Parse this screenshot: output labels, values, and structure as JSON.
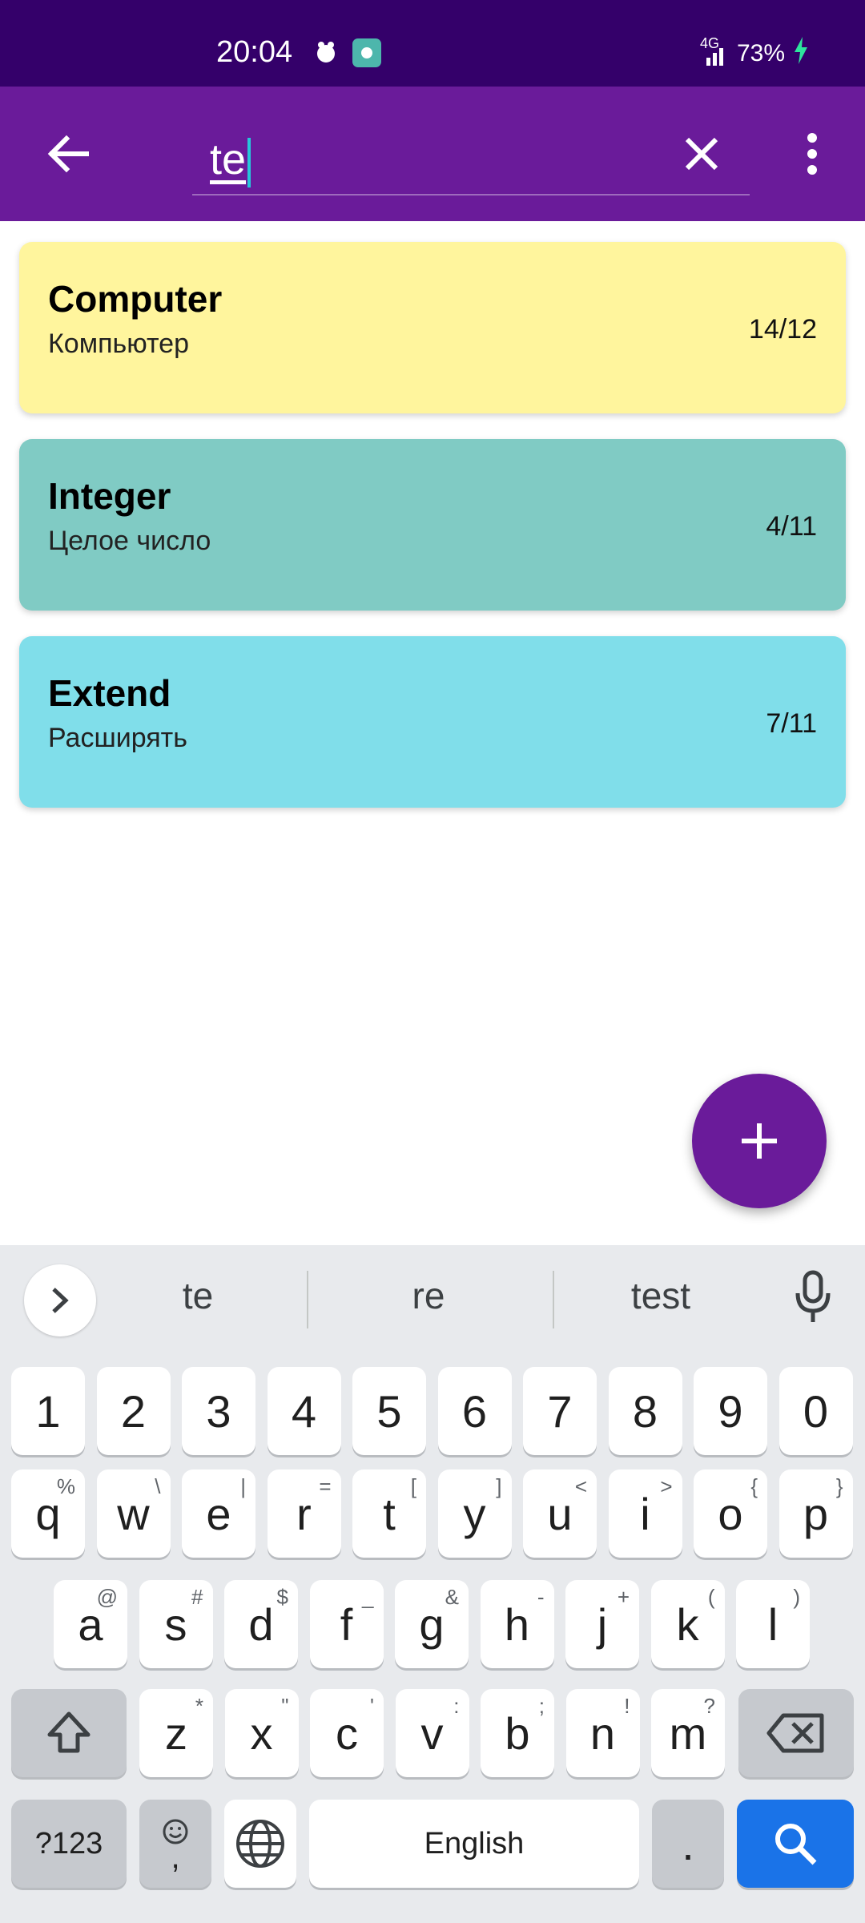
{
  "status_bar": {
    "time": "20:04",
    "network": "4G",
    "battery": "73%",
    "icons": [
      "notification-icon",
      "accessibility-icon",
      "signal-icon",
      "battery-charging-icon"
    ]
  },
  "app_bar": {
    "search_value": "te",
    "icons": [
      "back-arrow-icon",
      "clear-icon",
      "more-vert-icon"
    ]
  },
  "results": [
    {
      "word": "Computer",
      "translation": "Компьютер",
      "count": "14/12",
      "color": "#fff59d"
    },
    {
      "word": "Integer",
      "translation": "Целое число",
      "count": "4/11",
      "color": "#80cbc4"
    },
    {
      "word": "Extend",
      "translation": "Расширять",
      "count": "7/11",
      "color": "#80deea"
    }
  ],
  "fab": {
    "icon": "plus-icon",
    "color": "#6a1b9a"
  },
  "keyboard": {
    "suggestions": [
      "te",
      "re",
      "test"
    ],
    "row_numbers": [
      "1",
      "2",
      "3",
      "4",
      "5",
      "6",
      "7",
      "8",
      "9",
      "0"
    ],
    "row1": [
      {
        "k": "q",
        "s": "%"
      },
      {
        "k": "w",
        "s": "\\"
      },
      {
        "k": "e",
        "s": "|"
      },
      {
        "k": "r",
        "s": "="
      },
      {
        "k": "t",
        "s": "["
      },
      {
        "k": "y",
        "s": "]"
      },
      {
        "k": "u",
        "s": "<"
      },
      {
        "k": "i",
        "s": ">"
      },
      {
        "k": "o",
        "s": "{"
      },
      {
        "k": "p",
        "s": "}"
      }
    ],
    "row2": [
      {
        "k": "a",
        "s": "@"
      },
      {
        "k": "s",
        "s": "#"
      },
      {
        "k": "d",
        "s": "$"
      },
      {
        "k": "f",
        "s": "_"
      },
      {
        "k": "g",
        "s": "&"
      },
      {
        "k": "h",
        "s": "-"
      },
      {
        "k": "j",
        "s": "+"
      },
      {
        "k": "k",
        "s": "("
      },
      {
        "k": "l",
        "s": ")"
      }
    ],
    "row3": [
      {
        "k": "z",
        "s": "*"
      },
      {
        "k": "x",
        "s": "\""
      },
      {
        "k": "c",
        "s": "'"
      },
      {
        "k": "v",
        "s": ":"
      },
      {
        "k": "b",
        "s": ";"
      },
      {
        "k": "n",
        "s": "!"
      },
      {
        "k": "m",
        "s": "?"
      }
    ],
    "symbols_label": "?123",
    "emoji_comma_label": ",",
    "space_label": "English",
    "period_label": ".",
    "search_key_color": "#1a73e8"
  }
}
